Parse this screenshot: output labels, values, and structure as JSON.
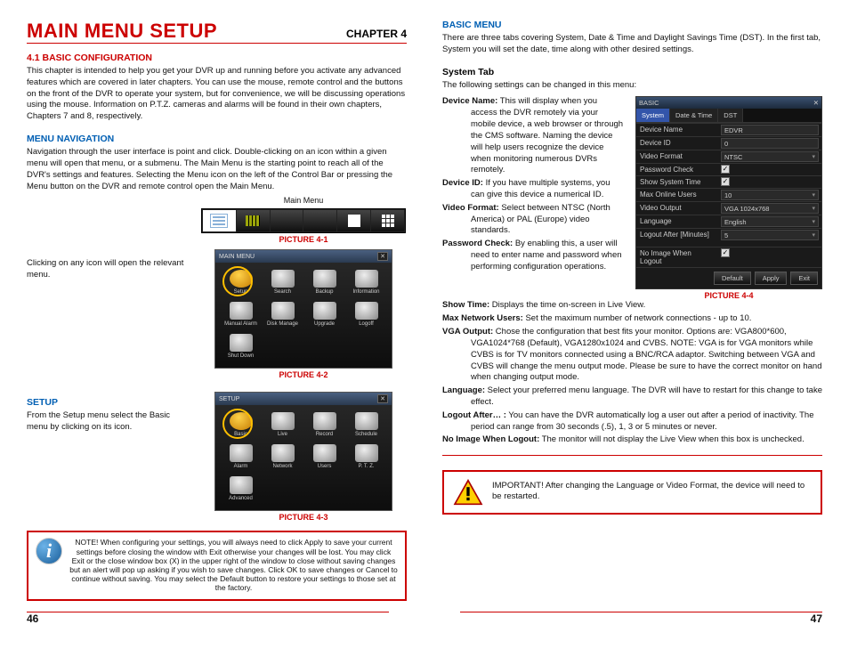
{
  "left": {
    "title": "MAIN MENU SETUP",
    "chapter": "CHAPTER 4",
    "sec1": "4.1 BASIC CONFIGURATION",
    "para1": "This chapter is intended to help you get your DVR up and running before you activate any advanced features which are covered in later chapters. You can use the mouse, remote control and the buttons on the front of the DVR to operate your system, but for convenience, we will be discussing operations using the mouse. Information on P.T.Z. cameras and alarms will be found in their own chapters, Chapters 7 and 8, respectively.",
    "nav_head": "MENU NAVIGATION",
    "nav_para": "Navigation through the user interface is point and click. Double-clicking on an icon within a given menu will open that menu, or a submenu. The Main Menu is the starting point to reach all of the DVR's settings and features. Selecting the Menu icon on the left of the Control Bar or pressing the Menu button on the DVR and remote control open the Main Menu.",
    "mainmenu_label": "Main Menu",
    "cap1": "PICTURE 4-1",
    "cap2": "PICTURE 4-2",
    "cap3": "PICTURE 4-3",
    "click_para": "Clicking on any icon will open the relevant menu.",
    "setup_head": "SETUP",
    "setup_para": "From the Setup menu select the Basic menu by clicking on its icon.",
    "icons2": [
      "Setup",
      "Search",
      "Backup",
      "Information",
      "Manual Alarm",
      "Disk Manage",
      "Upgrade",
      "Logoff",
      "Shut Down"
    ],
    "icons3": [
      "Basic",
      "Live",
      "Record",
      "Schedule",
      "Alarm",
      "Network",
      "Users",
      "P. T. Z.",
      "Advanced"
    ],
    "win2_title": "MAIN MENU",
    "win3_title": "SETUP",
    "note": "NOTE! When configuring your settings, you will always need to click Apply to save your current settings before closing the window with Exit otherwise your changes will be lost. You may click Exit or the close window box (X) in the upper right of the window to close without saving changes but an alert will pop up asking if you wish to save changes. Click OK to save changes or Cancel to continue without saving. You may select the Default button to restore your settings to those set at the factory.",
    "pagenum": "46"
  },
  "right": {
    "basic_head": "BASIC MENU",
    "basic_para": "There are three tabs covering System, Date & Time and Daylight Savings Time (DST). In the first tab, System you will set the date, time along with other desired settings.",
    "systab_head": "System Tab",
    "systab_para": "The following settings can be changed in this menu:",
    "items": {
      "deviceName_k": "Device Name:",
      "deviceName_v": " This will display when you access the DVR remotely via your mobile device, a web browser or through the CMS software. Naming the device will help users recognize the device when monitoring numerous DVRs remotely.",
      "deviceId_k": "Device ID:",
      "deviceId_v": " If you have multiple systems, you can give this device a numerical ID.",
      "vfmt_k": "Video Format:",
      "vfmt_v": " Select between NTSC (North America) or PAL (Europe) video standards.",
      "pw_k": "Password Check:",
      "pw_v": " By enabling this, a user will need to enter name and password when performing configuration operations.",
      "show_k": "Show Time:",
      "show_v": " Displays the time on-screen in Live View.",
      "max_k": "Max Network Users:",
      "max_v": " Set the maximum number of network connections - up to 10.",
      "vga_k": "VGA Output:",
      "vga_v": " Chose the configuration that best fits your monitor. Options are: VGA800*600, VGA1024*768 (Default), VGA1280x1024 and CVBS. NOTE: VGA is for VGA monitors while CVBS is for TV monitors connected using a BNC/RCA adaptor. Switching between VGA and CVBS will change the menu output mode. Please be sure to have the correct monitor on hand when changing output mode.",
      "lang_k": "Language:",
      "lang_v": " Select your preferred menu language. The DVR will have to restart for this change to take effect.",
      "logout_k": "Logout After… :",
      "logout_v": " You can have the DVR automatically log a user out after a period of inactivity. The period can range from 30 seconds (.5), 1, 3 or 5 minutes or never.",
      "noimg_k": "No Image When Logout:",
      "noimg_v": " The monitor will not display the Live View when this box is unchecked."
    },
    "cap4": "PICTURE 4-4",
    "settings": {
      "title": "BASIC",
      "tabs": [
        "System",
        "Date & Time",
        "DST"
      ],
      "rows": [
        {
          "k": "Device Name",
          "v": "EDVR",
          "type": "text"
        },
        {
          "k": "Device ID",
          "v": "0",
          "type": "text"
        },
        {
          "k": "Video Format",
          "v": "NTSC",
          "type": "drop"
        },
        {
          "k": "Password Check",
          "v": "",
          "type": "check"
        },
        {
          "k": "Show System Time",
          "v": "",
          "type": "check"
        },
        {
          "k": "Max Online Users",
          "v": "10",
          "type": "drop"
        },
        {
          "k": "Video Output",
          "v": "VGA 1024x768",
          "type": "drop"
        },
        {
          "k": "Language",
          "v": "English",
          "type": "drop"
        },
        {
          "k": "Logout After [Minutes]",
          "v": "5",
          "type": "drop"
        },
        {
          "k": "No Image When Logout",
          "v": "",
          "type": "check"
        }
      ],
      "buttons": [
        "Default",
        "Apply",
        "Exit"
      ]
    },
    "important": "IMPORTANT! After changing the Language or Video Format, the device will need to be restarted.",
    "pagenum": "47"
  }
}
